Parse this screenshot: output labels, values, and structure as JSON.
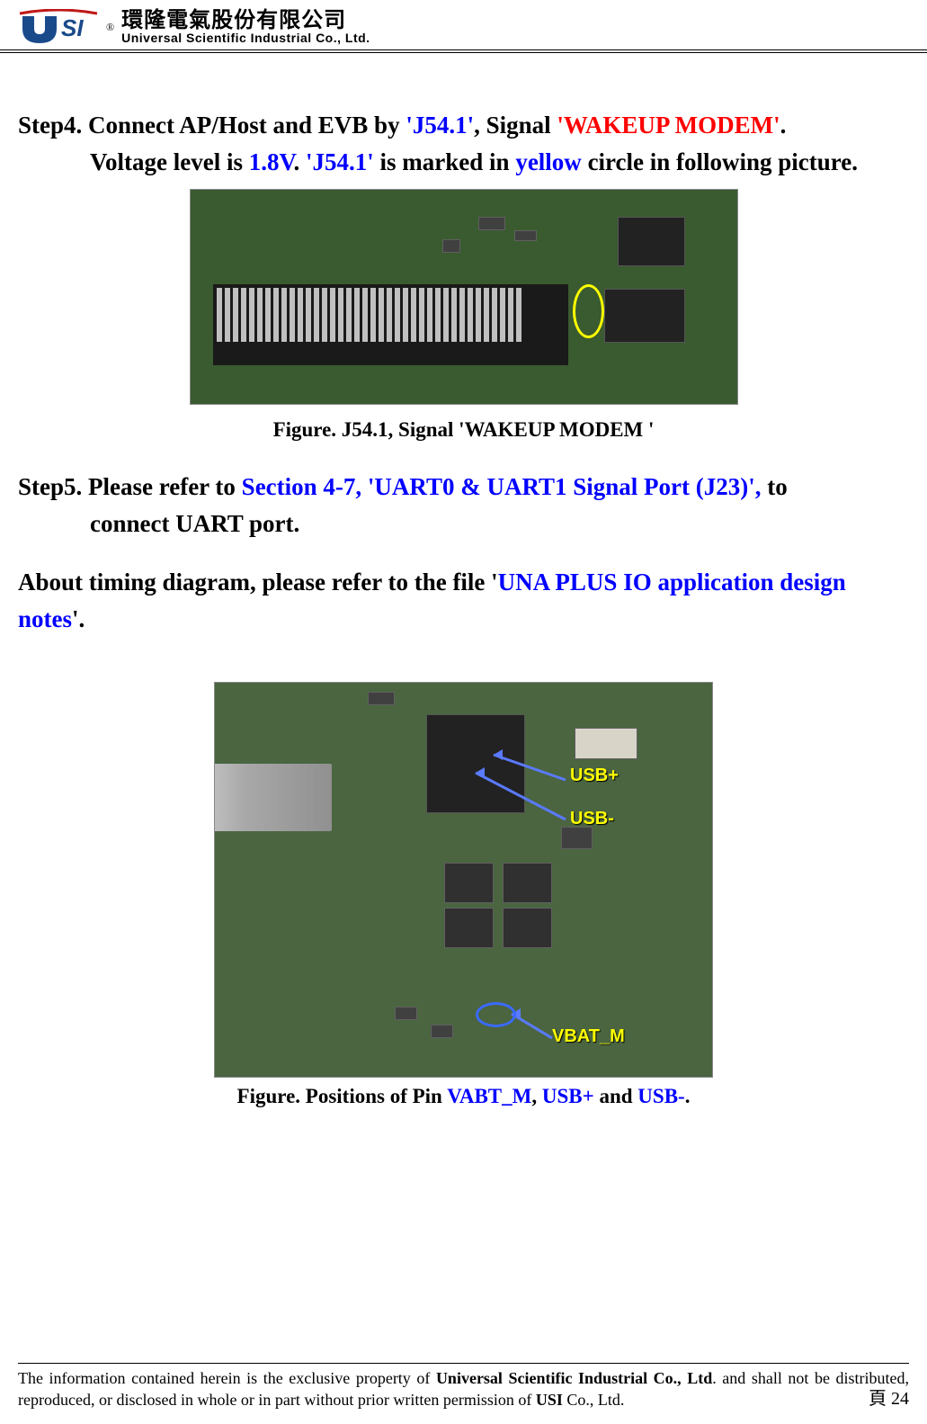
{
  "header": {
    "company_chinese": "環隆電氣股份有限公司",
    "company_english": "Universal Scientific Industrial Co., Ltd."
  },
  "content": {
    "step4": {
      "prefix": "Step4. Connect AP/Host and EVB by ",
      "j54_1": "'J54.1'",
      "mid1": ", Signal ",
      "wakeup": "'WAKEUP MODEM'",
      "period1": ".",
      "line2_pre": "Voltage level is ",
      "voltage": "1.8V",
      "line2_mid": ". ",
      "j54_again": "'J54.1'",
      "line2_mid2": " is marked in ",
      "yellow": "yellow",
      "line2_end": " circle in following picture."
    },
    "figure1_caption": "Figure. J54.1, Signal 'WAKEUP MODEM '",
    "step5": {
      "prefix": "Step5. Please refer to ",
      "section": "Section 4-7, 'UART0 & UART1 Signal Port (J23)', ",
      "suffix": "to",
      "line2": "connect UART port."
    },
    "about": {
      "prefix": "About timing diagram, please refer to the file '",
      "file": "UNA PLUS IO application design notes",
      "suffix": "'."
    },
    "figure2_caption_pre": "Figure. Positions of Pin ",
    "figure2_vabt": "VABT_M",
    "figure2_c1": ", ",
    "figure2_usbp": "USB+",
    "figure2_c2": " and ",
    "figure2_usbm": "USB-",
    "figure2_end": ".",
    "board2_labels": {
      "usb_plus": "USB+",
      "usb_minus": "USB-",
      "vbat_m": "VBAT_M"
    }
  },
  "footer": {
    "text_pre": "The information contained herein is the exclusive property of ",
    "company_bold": "Universal Scientific Industrial Co., Ltd",
    "text_mid": ". and shall not be distributed, reproduced, or disclosed in whole or in part without prior written permission of ",
    "usi_bold": "USI",
    "text_end": " Co., Ltd.",
    "page_prefix": "頁",
    "page_number": "24"
  }
}
